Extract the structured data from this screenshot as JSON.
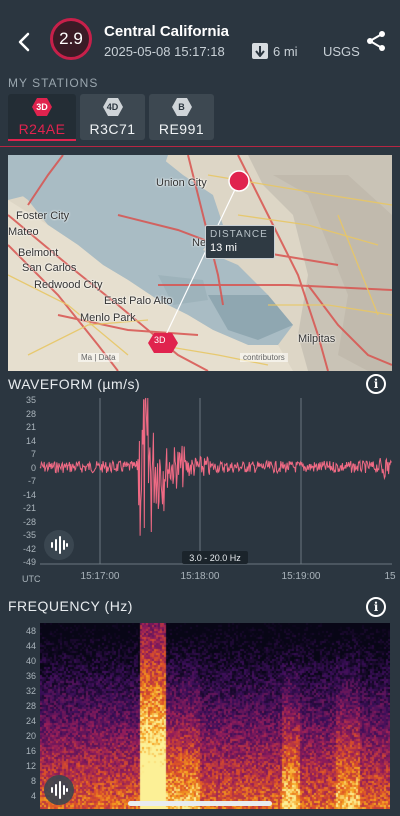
{
  "header": {
    "magnitude": "2.9",
    "title": "Central California",
    "datetime": "2025-05-08 15:17:18",
    "distance": "6 mi",
    "source": "USGS",
    "icons": {
      "back": "chevron-left-icon",
      "share": "share-icon",
      "distance": "arrow-down-icon"
    }
  },
  "stations": {
    "label": "MY STATIONS",
    "items": [
      {
        "tag": "3D",
        "name": "R24AE",
        "active": true,
        "color": "#e0234e"
      },
      {
        "tag": "4D",
        "name": "R3C71",
        "active": false,
        "color": "#cfd4d8"
      },
      {
        "tag": "B",
        "name": "RE991",
        "active": false,
        "color": "#cfd4d8"
      }
    ]
  },
  "map": {
    "labels": [
      "Union City",
      "Foster City",
      "Mateo",
      "Belmont",
      "San Carlos",
      "Redwood City",
      "East Palo Alto",
      "Menlo Park",
      "Ne",
      "Milpitas"
    ],
    "distance_tip": {
      "title": "DISTANCE",
      "value": "13 mi"
    },
    "station_marker": "3D",
    "attribution_left": "Ma",
    "attribution_mid": "Data",
    "attribution_right": "contributors"
  },
  "waveform": {
    "title": "WAVEFORM (µm/s)",
    "y_ticks": [
      "35",
      "28",
      "21",
      "14",
      "7",
      "0",
      "-7",
      "-14",
      "-21",
      "-28",
      "-35",
      "-42",
      "-49"
    ],
    "x_ticks": [
      "15:17:00",
      "15:18:00",
      "15:19:00",
      "15"
    ],
    "x_unit": "UTC",
    "filter": "3.0 - 20.0 Hz",
    "color": "#f06a84"
  },
  "frequency": {
    "title": "FREQUENCY (Hz)",
    "y_ticks": [
      "48",
      "44",
      "40",
      "36",
      "32",
      "28",
      "24",
      "20",
      "16",
      "12",
      "8",
      "4"
    ]
  },
  "colors": {
    "accent": "#e0234e",
    "background": "#2b3640"
  }
}
